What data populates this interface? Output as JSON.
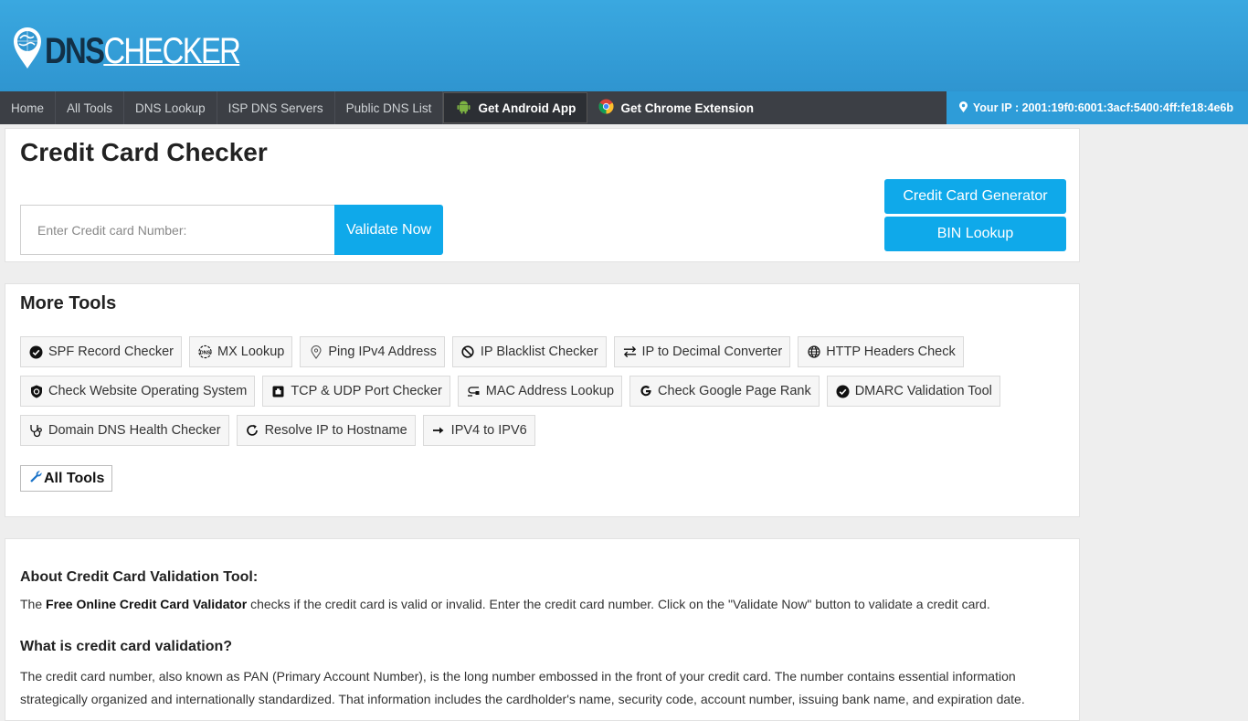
{
  "brand": {
    "dns": "DNS",
    "checker": "CHECKER"
  },
  "nav": {
    "items": [
      "Home",
      "All Tools",
      "DNS Lookup",
      "ISP DNS Servers",
      "Public DNS List"
    ],
    "android": "Get Android App",
    "chrome": "Get Chrome Extension",
    "ip": "Your IP : 2001:19f0:6001:3acf:5400:4ff:fe18:4e6b"
  },
  "checker": {
    "title": "Credit Card Checker",
    "placeholder": "Enter Credit card Number:",
    "validate": "Validate Now",
    "generator": "Credit Card Generator",
    "bin": "BIN Lookup"
  },
  "more_tools": {
    "title": "More Tools",
    "items": [
      {
        "label": "SPF Record Checker",
        "icon": "check-circle-icon"
      },
      {
        "label": "MX Lookup",
        "icon": "dns-icon"
      },
      {
        "label": "Ping IPv4 Address",
        "icon": "location-pin-icon"
      },
      {
        "label": "IP Blacklist Checker",
        "icon": "ban-icon"
      },
      {
        "label": "IP to Decimal Converter",
        "icon": "exchange-icon"
      },
      {
        "label": "HTTP Headers Check",
        "icon": "globe-icon"
      },
      {
        "label": "Check Website Operating System",
        "icon": "gear-shield-icon"
      },
      {
        "label": "TCP & UDP Port Checker",
        "icon": "port-icon"
      },
      {
        "label": "MAC Address Lookup",
        "icon": "cable-icon"
      },
      {
        "label": "Check Google Page Rank",
        "icon": "google-icon"
      },
      {
        "label": "DMARC Validation Tool",
        "icon": "check-circle-icon"
      },
      {
        "label": "Domain DNS Health Checker",
        "icon": "stethoscope-icon"
      },
      {
        "label": "Resolve IP to Hostname",
        "icon": "refresh-icon"
      },
      {
        "label": "IPV4 to IPV6",
        "icon": "arrow-right-icon"
      }
    ],
    "all_tools": "All Tools"
  },
  "about": {
    "heading": "About Credit Card Validation Tool:",
    "p_prefix": "The ",
    "p_bold": "Free Online Credit Card Validator",
    "p_rest": " checks if the credit card is valid or invalid. Enter the credit card number. Click on the \"Validate Now\" button to validate a credit card.",
    "what_heading": "What is credit card validation?",
    "what_text": "The credit card number, also known as PAN (Primary Account Number), is the long number embossed in the front of your credit card. The number contains essential information strategically organized and internationally standardized. That information includes the cardholder's name, security code, account number, issuing bank name, and expiration date."
  },
  "colors": {
    "header": "#3aa8e0",
    "nav": "#3c3f45",
    "accent": "#0fa9ea"
  }
}
